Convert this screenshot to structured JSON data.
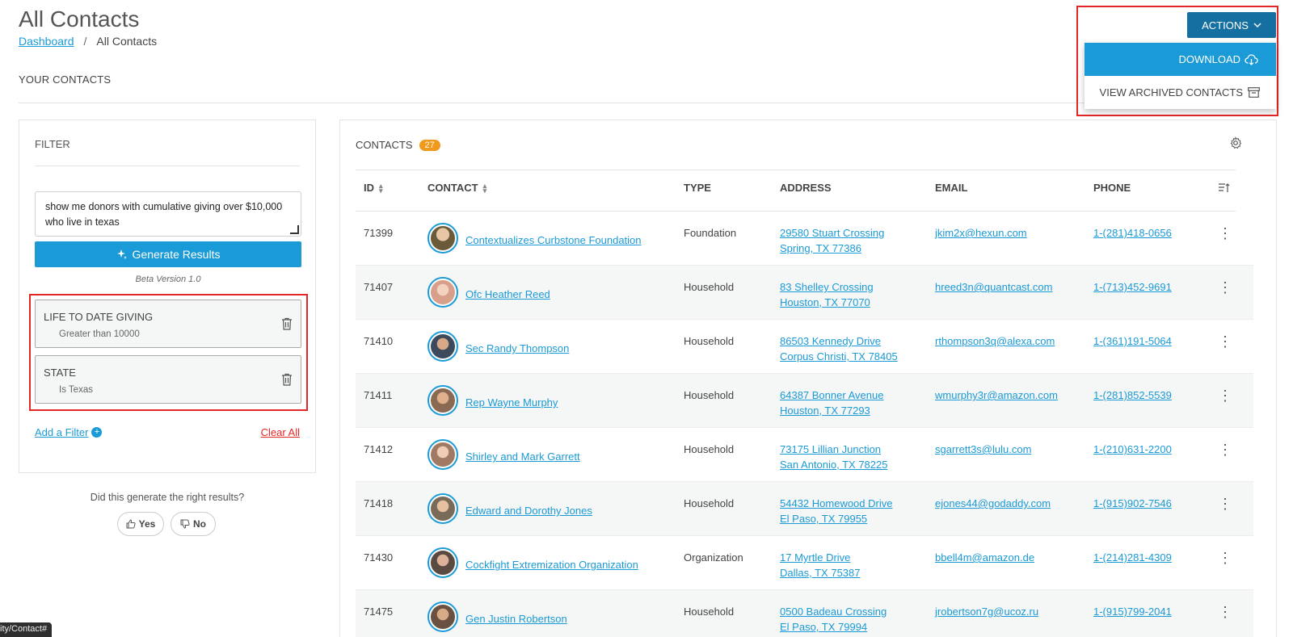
{
  "header": {
    "title": "All Contacts",
    "breadcrumb": {
      "link": "Dashboard",
      "separator": "/",
      "current": "All Contacts"
    },
    "section_label": "YOUR CONTACTS"
  },
  "actions": {
    "button_label": "ACTIONS",
    "download_label": "DOWNLOAD",
    "archived_label": "VIEW ARCHIVED CONTACTS"
  },
  "filter": {
    "title": "FILTER",
    "query_line1": "show me donors with cumulative giving over $10,000",
    "query_line2": "who live in texas",
    "generate_label": "Generate Results",
    "beta_label": "Beta Version 1.0",
    "cards": [
      {
        "title": "LIFE TO DATE GIVING",
        "subtitle": "Greater than 10000"
      },
      {
        "title": "STATE",
        "subtitle": "Is Texas"
      }
    ],
    "add_filter_label": "Add a Filter",
    "clear_all_label": "Clear All"
  },
  "feedback": {
    "question": "Did this generate the right results?",
    "yes_label": "Yes",
    "no_label": "No"
  },
  "contacts": {
    "title": "CONTACTS",
    "count": "27",
    "columns": {
      "id": "ID",
      "contact": "CONTACT",
      "type": "TYPE",
      "address": "ADDRESS",
      "email": "EMAIL",
      "phone": "PHONE"
    },
    "rows": [
      {
        "id": "71399",
        "name": "Contextualizes Curbstone Foundation",
        "type": "Foundation",
        "addr1": "29580 Stuart Crossing",
        "addr2": "Spring, TX 77386",
        "email": "jkim2x@hexun.com",
        "phone": "1-(281)418-0656",
        "avatar_color": "#6b5a3a"
      },
      {
        "id": "71407",
        "name": "Ofc Heather Reed",
        "type": "Household",
        "addr1": "83 Shelley Crossing",
        "addr2": "Houston, TX 77070",
        "email": "hreed3n@quantcast.com",
        "phone": "1-(713)452-9691",
        "avatar_color": "#d8a08a"
      },
      {
        "id": "71410",
        "name": "Sec Randy Thompson",
        "type": "Household",
        "addr1": "86503 Kennedy Drive",
        "addr2": "Corpus Christi, TX 78405",
        "email": "rthompson3q@alexa.com",
        "phone": "1-(361)191-5064",
        "avatar_color": "#3d4a5c"
      },
      {
        "id": "71411",
        "name": "Rep Wayne Murphy",
        "type": "Household",
        "addr1": "64387 Bonner Avenue",
        "addr2": "Houston, TX 77293",
        "email": "wmurphy3r@amazon.com",
        "phone": "1-(281)852-5539",
        "avatar_color": "#8a6a52"
      },
      {
        "id": "71412",
        "name": "Shirley and Mark Garrett",
        "type": "Household",
        "addr1": "73175 Lillian Junction",
        "addr2": "San Antonio, TX 78225",
        "email": "sgarrett3s@lulu.com",
        "phone": "1-(210)631-2200",
        "avatar_color": "#a07a62"
      },
      {
        "id": "71418",
        "name": "Edward and Dorothy Jones",
        "type": "Household",
        "addr1": "54432 Homewood Drive",
        "addr2": "El Paso, TX 79955",
        "email": "ejones44@godaddy.com",
        "phone": "1-(915)902-7546",
        "avatar_color": "#7a6a5a"
      },
      {
        "id": "71430",
        "name": "Cockfight Extremization Organization",
        "type": "Organization",
        "addr1": "17 Myrtle Drive",
        "addr2": "Dallas, TX 75387",
        "email": "bbell4m@amazon.de",
        "phone": "1-(214)281-4309",
        "avatar_color": "#5a4a42"
      },
      {
        "id": "71475",
        "name": "Gen Justin Robertson",
        "type": "Household",
        "addr1": "0500 Badeau Crossing",
        "addr2": "El Paso, TX 79994",
        "email": "jrobertson7g@ucoz.ru",
        "phone": "1-(915)799-2041",
        "avatar_color": "#6a5040"
      }
    ]
  },
  "status_url": "ity/Contact#",
  "colors": {
    "primary": "#1a9ad6",
    "actions": "#156fa0",
    "badge": "#f0991d",
    "highlight": "#e32626"
  }
}
